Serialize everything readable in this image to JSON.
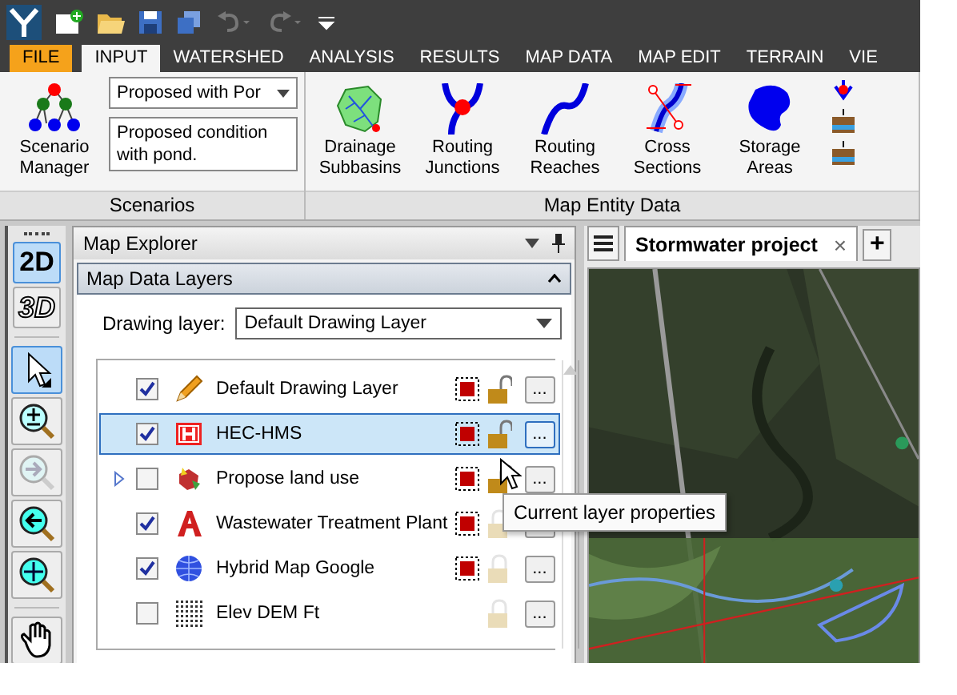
{
  "menu_tabs": [
    {
      "label": "FILE",
      "kind": "file",
      "selected": false
    },
    {
      "label": "INPUT",
      "kind": "tab",
      "selected": true
    },
    {
      "label": "WATERSHED",
      "kind": "tab",
      "selected": false
    },
    {
      "label": "ANALYSIS",
      "kind": "tab",
      "selected": false
    },
    {
      "label": "RESULTS",
      "kind": "tab",
      "selected": false
    },
    {
      "label": "MAP DATA",
      "kind": "tab",
      "selected": false
    },
    {
      "label": "MAP EDIT",
      "kind": "tab",
      "selected": false
    },
    {
      "label": "TERRAIN",
      "kind": "tab",
      "selected": false
    },
    {
      "label": "VIE",
      "kind": "tab",
      "selected": false
    }
  ],
  "scenarios": {
    "button": "Scenario Manager",
    "scenario": "Proposed with Por",
    "description": "Proposed condition with pond.",
    "group": "Scenarios"
  },
  "map_entity_data": {
    "group": "Map Entity Data",
    "buttons": [
      {
        "label": "Drainage Subbasins",
        "kind": "subbasin"
      },
      {
        "label": "Routing Junctions",
        "kind": "junction"
      },
      {
        "label": "Routing Reaches",
        "kind": "reach"
      },
      {
        "label": "Cross Sections",
        "kind": "section"
      },
      {
        "label": "Storage Areas",
        "kind": "storage"
      }
    ]
  },
  "map_explorer": {
    "title": "Map Explorer",
    "section": "Map Data Layers",
    "drawing_layer_label": "Drawing layer:",
    "drawing_layer": "Default Drawing Layer",
    "layers": [
      {
        "name": "Default Drawing Layer",
        "kind": "pencil",
        "checked": true,
        "selected": false,
        "expandable": false,
        "locked": false,
        "lock_enabled": true,
        "swatch": true
      },
      {
        "name": "HEC-HMS",
        "kind": "hms",
        "checked": true,
        "selected": true,
        "expandable": false,
        "locked": false,
        "lock_enabled": true,
        "swatch": true
      },
      {
        "name": "Propose land use",
        "kind": "landuse",
        "checked": false,
        "selected": false,
        "expandable": true,
        "locked": false,
        "lock_enabled": true,
        "swatch": true
      },
      {
        "name": "Wastewater Treatment Plant",
        "kind": "cad",
        "checked": true,
        "selected": false,
        "expandable": false,
        "locked": true,
        "lock_enabled": false,
        "swatch": true
      },
      {
        "name": "Hybrid Map Google",
        "kind": "globe",
        "checked": true,
        "selected": false,
        "expandable": false,
        "locked": true,
        "lock_enabled": false,
        "swatch": true
      },
      {
        "name": "Elev DEM Ft",
        "kind": "grid",
        "checked": false,
        "selected": false,
        "expandable": false,
        "locked": true,
        "lock_enabled": false,
        "swatch": false
      }
    ],
    "properties_button": "...",
    "tooltip": "Current layer properties"
  },
  "map_view": {
    "tab": "Stormwater project",
    "close": "×",
    "add": "+"
  },
  "view_tools": [
    {
      "label": "2D",
      "kind": "flat",
      "selected": true
    },
    {
      "label": "3D",
      "kind": "relief",
      "selected": false
    }
  ]
}
